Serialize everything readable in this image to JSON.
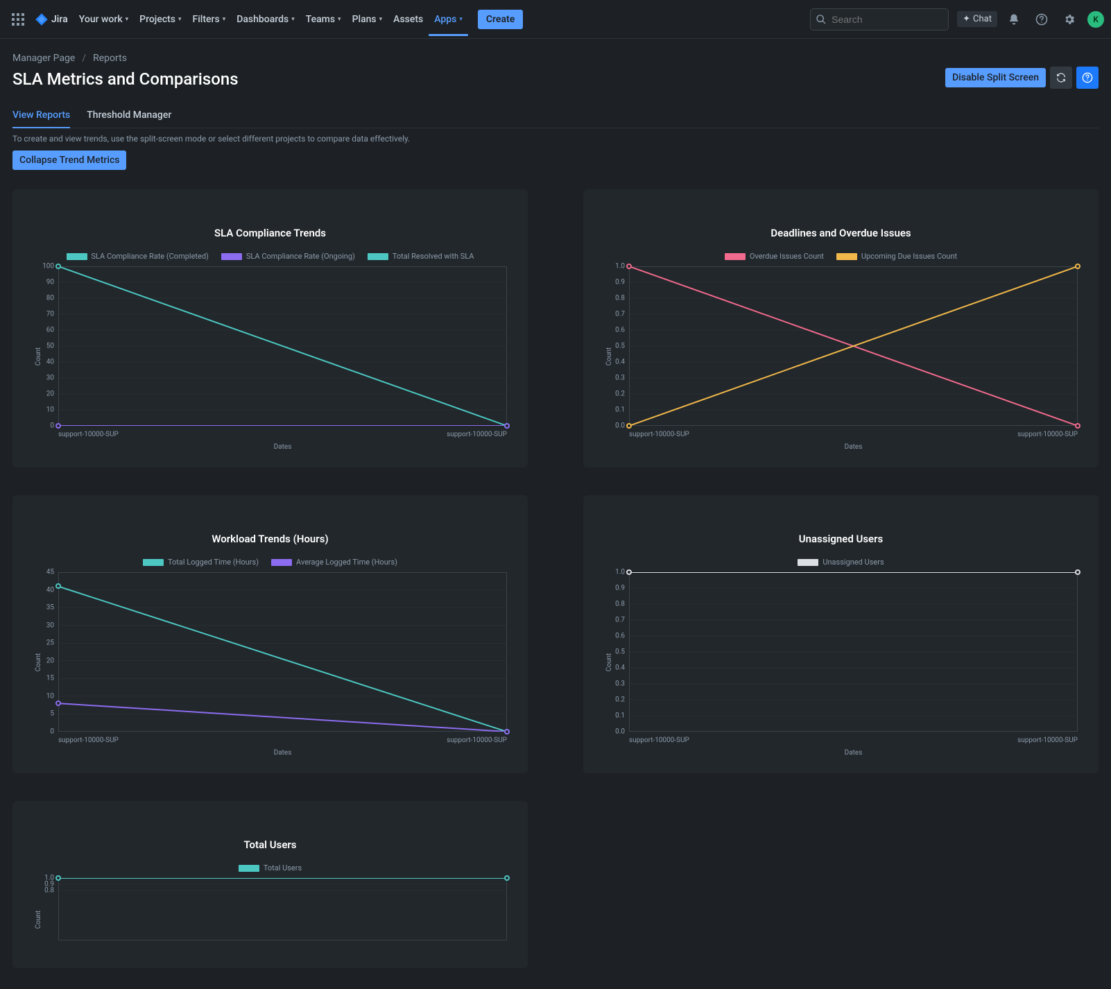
{
  "nav": {
    "logoText": "Jira",
    "items": [
      {
        "label": "Your work",
        "hasChev": true,
        "active": false
      },
      {
        "label": "Projects",
        "hasChev": true,
        "active": false
      },
      {
        "label": "Filters",
        "hasChev": true,
        "active": false
      },
      {
        "label": "Dashboards",
        "hasChev": true,
        "active": false
      },
      {
        "label": "Teams",
        "hasChev": true,
        "active": false
      },
      {
        "label": "Plans",
        "hasChev": true,
        "active": false
      },
      {
        "label": "Assets",
        "hasChev": false,
        "active": false
      },
      {
        "label": "Apps",
        "hasChev": true,
        "active": true
      }
    ],
    "create": "Create",
    "searchPlaceholder": "Search",
    "chat": "Chat",
    "avatarInitial": "K"
  },
  "page": {
    "crumb1": "Manager Page",
    "crumb2": "Reports",
    "title": "SLA Metrics and Comparisons",
    "disableSplit": "Disable Split Screen",
    "tabs": [
      {
        "label": "View Reports",
        "active": true
      },
      {
        "label": "Threshold Manager",
        "active": false
      }
    ],
    "hint": "To create and view trends, use the split-screen mode or select different projects to compare data effectively.",
    "collapse": "Collapse Trend Metrics"
  },
  "axisTitles": {
    "x": "Dates",
    "y": "Count"
  },
  "xticks": [
    "support-10000-SUP",
    "support-10000-SUP"
  ],
  "chart_data": [
    {
      "type": "line",
      "title": "SLA Compliance Trends",
      "xlabel": "Dates",
      "ylabel": "Count",
      "categories": [
        "support-10000-SUP",
        "support-10000-SUP"
      ],
      "ylim": [
        0,
        100
      ],
      "yticks": [
        0,
        10,
        20,
        30,
        40,
        50,
        60,
        70,
        80,
        90,
        100
      ],
      "series": [
        {
          "name": "SLA Compliance Rate (Completed)",
          "color": "#4CC7C2",
          "values": [
            100,
            0
          ]
        },
        {
          "name": "SLA Compliance Rate (Ongoing)",
          "color": "#8C6CF0",
          "values": [
            0,
            0
          ]
        },
        {
          "name": "Total Resolved with SLA",
          "color": "#4CC7C2",
          "values": [
            100,
            0
          ],
          "hidden": true
        }
      ]
    },
    {
      "type": "line",
      "title": "Deadlines and Overdue Issues",
      "xlabel": "Dates",
      "ylabel": "Count",
      "categories": [
        "support-10000-SUP",
        "support-10000-SUP"
      ],
      "ylim": [
        0,
        1
      ],
      "yticks": [
        0,
        0.1,
        0.2,
        0.3,
        0.4,
        0.5,
        0.6,
        0.7,
        0.8,
        0.9,
        1.0
      ],
      "series": [
        {
          "name": "Overdue Issues Count",
          "color": "#F26A8D",
          "values": [
            1,
            0
          ]
        },
        {
          "name": "Upcoming Due Issues Count",
          "color": "#F2B94A",
          "values": [
            0,
            1
          ]
        }
      ]
    },
    {
      "type": "line",
      "title": "Workload Trends (Hours)",
      "xlabel": "Dates",
      "ylabel": "Count",
      "categories": [
        "support-10000-SUP",
        "support-10000-SUP"
      ],
      "ylim": [
        0,
        45
      ],
      "yticks": [
        0,
        5,
        10,
        15,
        20,
        25,
        30,
        35,
        40,
        45
      ],
      "series": [
        {
          "name": "Total Logged Time (Hours)",
          "color": "#4CC7C2",
          "values": [
            41,
            0
          ]
        },
        {
          "name": "Average Logged Time (Hours)",
          "color": "#8C6CF0",
          "values": [
            8,
            0
          ]
        }
      ]
    },
    {
      "type": "line",
      "title": "Unassigned Users",
      "xlabel": "Dates",
      "ylabel": "Count",
      "categories": [
        "support-10000-SUP",
        "support-10000-SUP"
      ],
      "ylim": [
        0,
        1
      ],
      "yticks": [
        0,
        0.1,
        0.2,
        0.3,
        0.4,
        0.5,
        0.6,
        0.7,
        0.8,
        0.9,
        1.0
      ],
      "series": [
        {
          "name": "Unassigned Users",
          "color": "#DCDFE4",
          "values": [
            1,
            1
          ]
        }
      ]
    },
    {
      "type": "line",
      "title": "Total Users",
      "xlabel": "Dates",
      "ylabel": "Count",
      "categories": [
        "support-10000-SUP",
        "support-10000-SUP"
      ],
      "ylim": [
        0,
        1
      ],
      "yticks": [
        0.8,
        0.9,
        1.0
      ],
      "series": [
        {
          "name": "Total Users",
          "color": "#4CC7C2",
          "values": [
            1,
            1
          ]
        }
      ],
      "truncated": true
    }
  ]
}
